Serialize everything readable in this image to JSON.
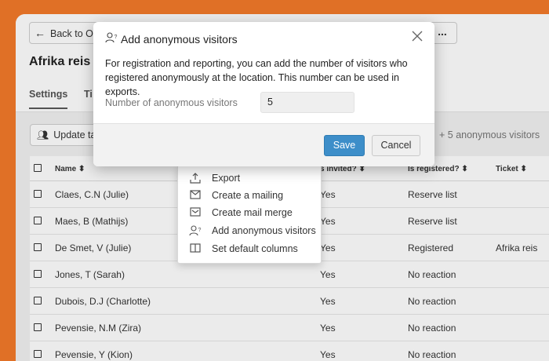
{
  "header": {
    "back_label": "Back to Ov",
    "back_icon": "arrow-left-icon",
    "more_label": "...",
    "title": "Afrika reis"
  },
  "tabs": [
    {
      "label": "Settings"
    },
    {
      "label": "Ti"
    }
  ],
  "toolbar": {
    "update_label": "Update ta",
    "anon_summary": "+ 5 anonymous visitors"
  },
  "table": {
    "columns": [
      "Name",
      "s invited?",
      "Is registered?",
      "Ticket"
    ],
    "rows": [
      {
        "name": "Claes, C.N (Julie)",
        "invited": "Yes",
        "registered": "Reserve list",
        "ticket": ""
      },
      {
        "name": "Maes, B (Mathijs)",
        "invited": "Yes",
        "registered": "Reserve list",
        "ticket": ""
      },
      {
        "name": "De Smet, V (Julie)",
        "invited": "Yes",
        "registered": "Registered",
        "ticket": "Afrika reis"
      },
      {
        "name": "Jones, T (Sarah)",
        "invited": "Yes",
        "registered": "No reaction",
        "ticket": ""
      },
      {
        "name": "Dubois, D.J (Charlotte)",
        "invited": "Yes",
        "registered": "No reaction",
        "ticket": ""
      },
      {
        "name": "Pevensie, N.M (Zira)",
        "invited": "Yes",
        "registered": "No reaction",
        "ticket": ""
      },
      {
        "name": "Pevensie, Y (Kion)",
        "invited": "Yes",
        "registered": "No reaction",
        "ticket": ""
      }
    ]
  },
  "context_menu": {
    "items": [
      {
        "label": "Export",
        "icon": "upload-icon"
      },
      {
        "label": "Create a mailing",
        "icon": "envelope-icon"
      },
      {
        "label": "Create mail merge",
        "icon": "mail-merge-icon"
      },
      {
        "label": "Add anonymous visitors",
        "icon": "anonymous-user-icon"
      },
      {
        "label": "Set default columns",
        "icon": "columns-icon"
      }
    ]
  },
  "modal": {
    "title": "Add anonymous visitors",
    "description": "For registration and reporting, you can add the number of visitors who registered anonymously at the location. This number can be used in exports.",
    "field_label": "Number of anonymous visitors",
    "field_value": "5",
    "save_label": "Save",
    "cancel_label": "Cancel"
  },
  "colors": {
    "background": "#f47a2a",
    "primary_button": "#3d8ec9"
  }
}
